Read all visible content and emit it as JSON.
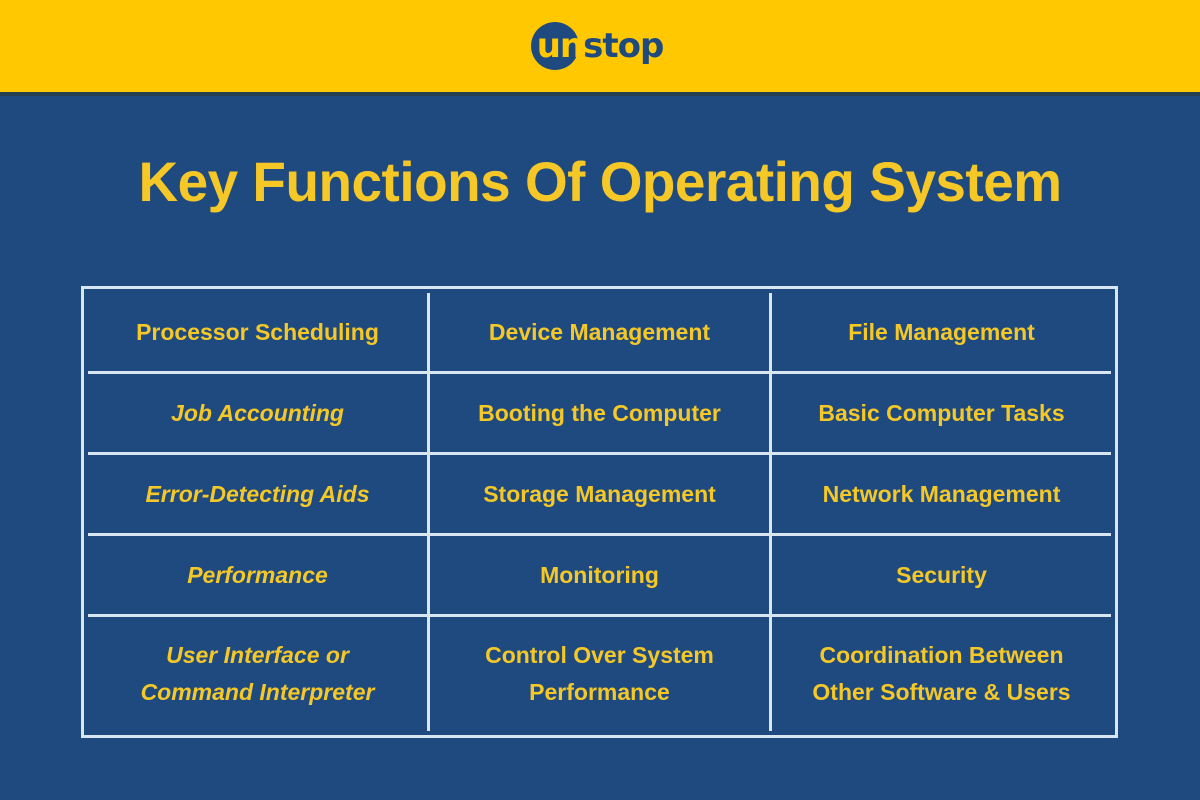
{
  "brand": {
    "logo_name": "unstop",
    "logo_part_circle": "un",
    "logo_part_plain": "stop",
    "bar_color": "#FFC800",
    "logo_circle_color": "#1e4a80"
  },
  "page": {
    "title": "Key Functions Of Operating System",
    "background_color": "#1e4a80",
    "accent_text_color": "#F5C827",
    "grid_line_color": "#d8e6f2"
  },
  "table": {
    "columns": 3,
    "rows": 5,
    "cells": [
      [
        {
          "text": "Processor Scheduling",
          "italic": false
        },
        {
          "text": "Device Management",
          "italic": false
        },
        {
          "text": "File Management",
          "italic": false
        }
      ],
      [
        {
          "text": "Job Accounting",
          "italic": true
        },
        {
          "text": "Booting the Computer",
          "italic": false
        },
        {
          "text": "Basic Computer Tasks",
          "italic": false
        }
      ],
      [
        {
          "text": "Error-Detecting Aids",
          "italic": true
        },
        {
          "text": "Storage Management",
          "italic": false
        },
        {
          "text": "Network Management",
          "italic": false
        }
      ],
      [
        {
          "text": "Performance",
          "italic": true
        },
        {
          "text": "Monitoring",
          "italic": false
        },
        {
          "text": "Security",
          "italic": false
        }
      ],
      [
        {
          "text": "User Interface or\nCommand Interpreter",
          "italic": true
        },
        {
          "text": "Control Over System\nPerformance",
          "italic": false
        },
        {
          "text": "Coordination Between\nOther Software & Users",
          "italic": false
        }
      ]
    ]
  }
}
